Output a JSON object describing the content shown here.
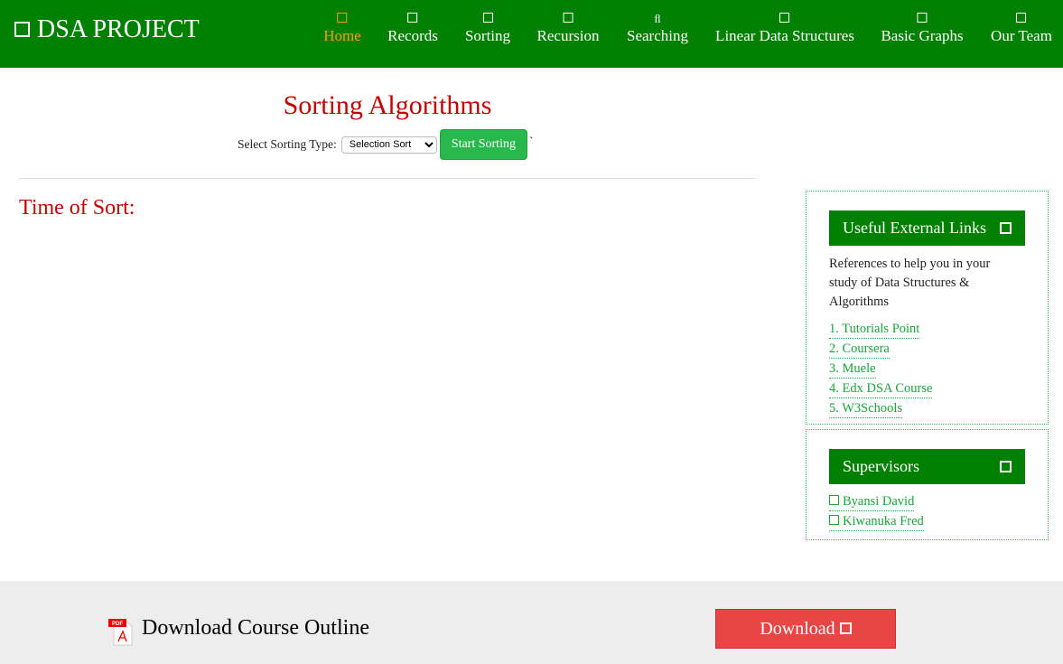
{
  "nav": {
    "brand": "DSA PROJECT",
    "items": [
      {
        "label": "Home",
        "icon": "square-icon"
      },
      {
        "label": "Records",
        "icon": "square-icon"
      },
      {
        "label": "Sorting",
        "icon": "square-icon"
      },
      {
        "label": "Recursion",
        "icon": "square-icon"
      },
      {
        "label": "Searching",
        "icon": "fl",
        "glyph": "ﬂ"
      },
      {
        "label": "Linear Data Structures",
        "icon": "square-icon"
      },
      {
        "label": "Basic Graphs",
        "icon": "square-icon"
      },
      {
        "label": "Our Team",
        "icon": "square-icon"
      }
    ]
  },
  "main": {
    "title": "Sorting Algorithms",
    "select_label": "Select Sorting Type:",
    "select_value": "Selection Sort",
    "start_button": "Start Sorting",
    "stray": "`",
    "time_label": "Time of Sort:"
  },
  "links_box": {
    "title": "Useful External Links",
    "desc": "References to help you in your study of Data Structures & Algorithms",
    "links": [
      "1. Tutorials Point",
      "2. Coursera",
      "3. Muele",
      "4. Edx DSA Course",
      "5. W3Schools"
    ]
  },
  "supervisors": {
    "title": "Supervisors",
    "names": [
      "Byansi David",
      "Kiwanuka Fred"
    ]
  },
  "footer": {
    "pdf_label": "PDF",
    "outline_text": "Download Course Outline",
    "download_button": "Download"
  },
  "colors": {
    "nav": "#008000",
    "active": "#f5a000",
    "title": "#c00000",
    "button": "#28b84c",
    "download": "#e84545"
  }
}
